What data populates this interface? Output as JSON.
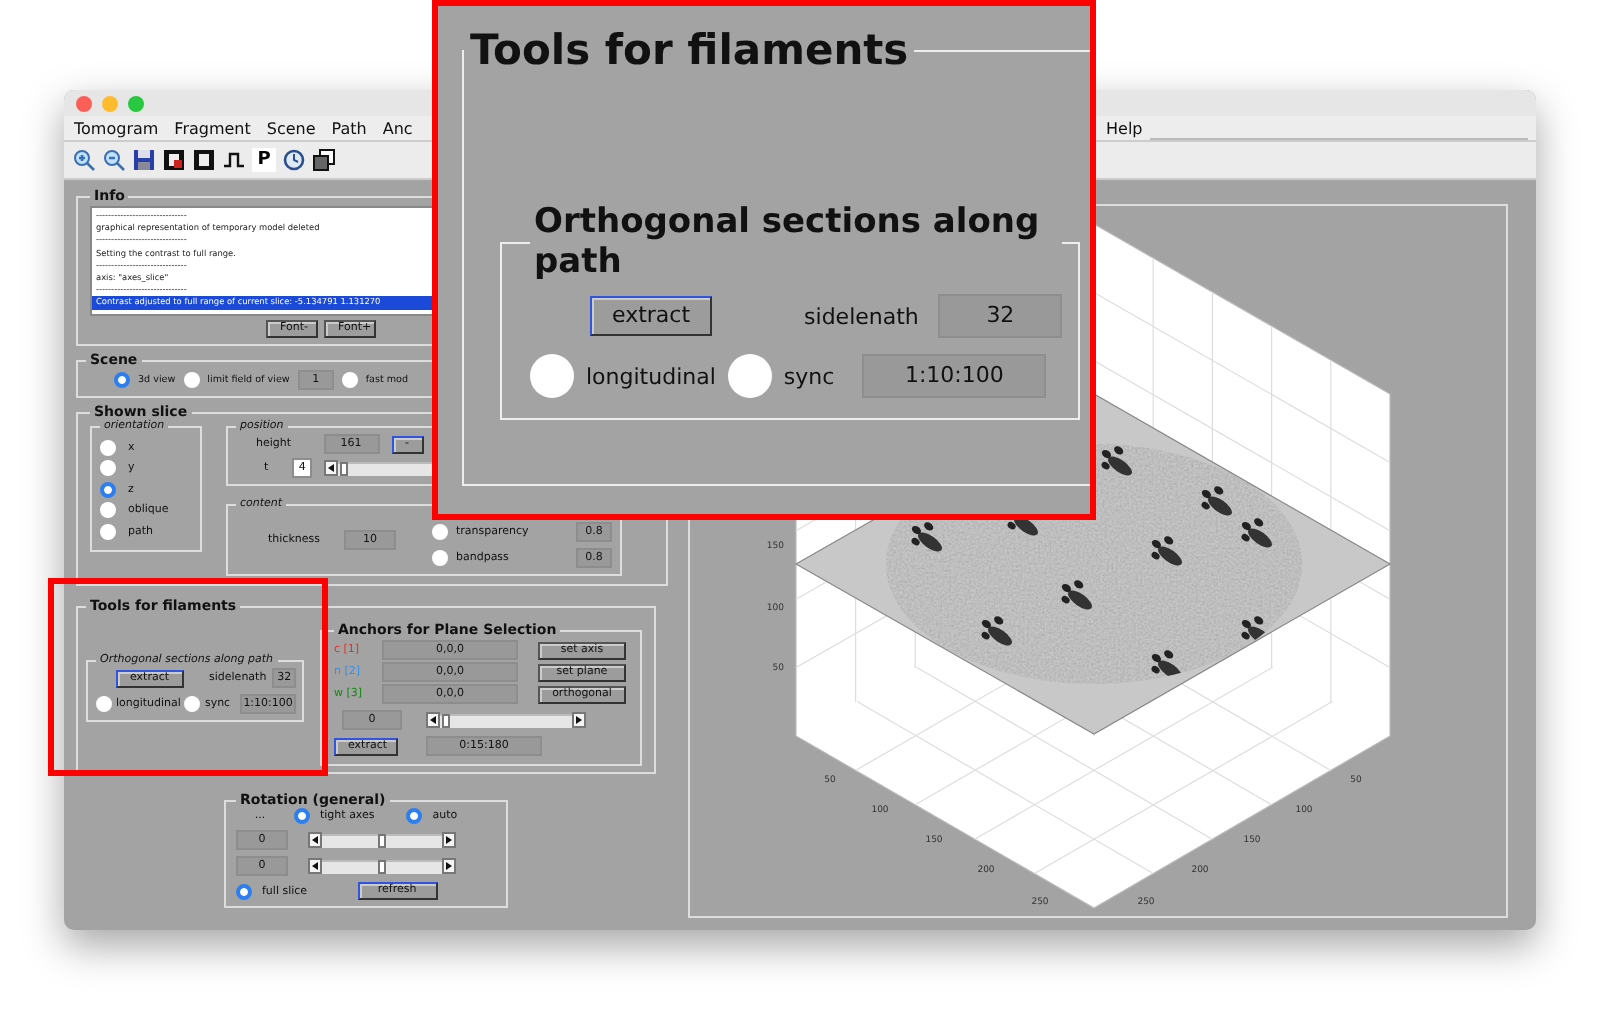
{
  "menu": [
    "Tomogram",
    "Fragment",
    "Scene",
    "Path",
    "Anc"
  ],
  "menu_right": [
    "Help"
  ],
  "toolbar": {
    "letter_button": "P"
  },
  "info": {
    "title": "Info",
    "log": [
      {
        "text": "------------------------------",
        "selected": false
      },
      {
        "text": "graphical representation of temporary model deleted",
        "selected": false
      },
      {
        "text": "------------------------------",
        "selected": false
      },
      {
        "text": "Setting the contrast to full range.",
        "selected": false
      },
      {
        "text": "------------------------------",
        "selected": false
      },
      {
        "text": "axis: \"axes_slice\"",
        "selected": false
      },
      {
        "text": "------------------------------",
        "selected": false
      },
      {
        "text": "Contrast adjusted to full range of current slice: -5.134791 1.131270",
        "selected": true
      }
    ],
    "buttons": [
      "Font-",
      "Font+"
    ]
  },
  "scene": {
    "title": "Scene",
    "options": [
      {
        "label": "3d view",
        "selected": true
      },
      {
        "label": "limit field of view",
        "selected": false
      }
    ],
    "field_value": "1",
    "fast_mode": {
      "label": "fast mod",
      "selected": false
    }
  },
  "shown_slice": {
    "title": "Shown slice",
    "orientation": {
      "title": "orientation",
      "options": [
        {
          "label": "x",
          "selected": false
        },
        {
          "label": "y",
          "selected": false
        },
        {
          "label": "z",
          "selected": true
        },
        {
          "label": "oblique",
          "selected": false
        },
        {
          "label": "path",
          "selected": false
        }
      ]
    },
    "position": {
      "title": "position",
      "height_label": "height",
      "height_value": "161",
      "minus_button": "-",
      "t_label": "t",
      "t_value": "4",
      "t_slider": {
        "level": 0.02
      }
    },
    "content": {
      "title": "content",
      "thickness_label": "thickness",
      "thickness_value": "10",
      "transparency": {
        "label": "transparency",
        "selected": false,
        "value": "0.8"
      },
      "bandpass": {
        "label": "bandpass",
        "selected": false,
        "value": "0.8"
      }
    }
  },
  "tools": {
    "title": "Tools for filaments",
    "orthogonal": {
      "title": "Orthogonal sections along path",
      "extract": "extract",
      "sidelength_label": "sidelenath",
      "sidelength_value": "32",
      "longitudinal": {
        "label": "longitudinal",
        "selected": false
      },
      "sync": {
        "label": "sync",
        "selected": false
      },
      "range": "1:10:100"
    },
    "anchors": {
      "title": "Anchors for Plane Selection",
      "rows": [
        {
          "label": "c [1]",
          "color": "#e03030",
          "value": "0,0,0",
          "button": "set axis"
        },
        {
          "label": "n [2]",
          "color": "#3a8ee0",
          "value": "0,0,0",
          "button": "set plane"
        },
        {
          "label": "w [3]",
          "color": "#0e8a0e",
          "value": "0,0,0",
          "button": "orthogonal"
        }
      ],
      "angle_value": "0",
      "level": 0.02,
      "extract": "extract",
      "range": "0:15:180"
    }
  },
  "rotation": {
    "title": "Rotation (general)",
    "label": "...",
    "tight_axes": {
      "label": "tight axes",
      "selected": true
    },
    "auto": {
      "label": "auto",
      "selected": true
    },
    "sliders": [
      {
        "value": "0",
        "level": 0.5
      },
      {
        "value": "0",
        "level": 0.5
      }
    ],
    "full_slice": {
      "label": "full slice",
      "selected": true
    },
    "refresh": "refresh"
  },
  "plot": {
    "z_ticks": [
      "150",
      "100",
      "50"
    ],
    "x_ticks": [
      "50",
      "100",
      "150",
      "200",
      "250"
    ],
    "y_ticks": [
      "50",
      "100",
      "150",
      "200",
      "250"
    ]
  },
  "callout": {
    "title": "Tools for filaments",
    "orthogonal": {
      "title": "Orthogonal sections along path",
      "extract": "extract",
      "sidelength_label": "sidelenath",
      "sidelength_value": "32",
      "longitudinal": {
        "label": "longitudinal",
        "selected": false
      },
      "sync": {
        "label": "sync",
        "selected": false
      },
      "range": "1:10:100"
    }
  }
}
